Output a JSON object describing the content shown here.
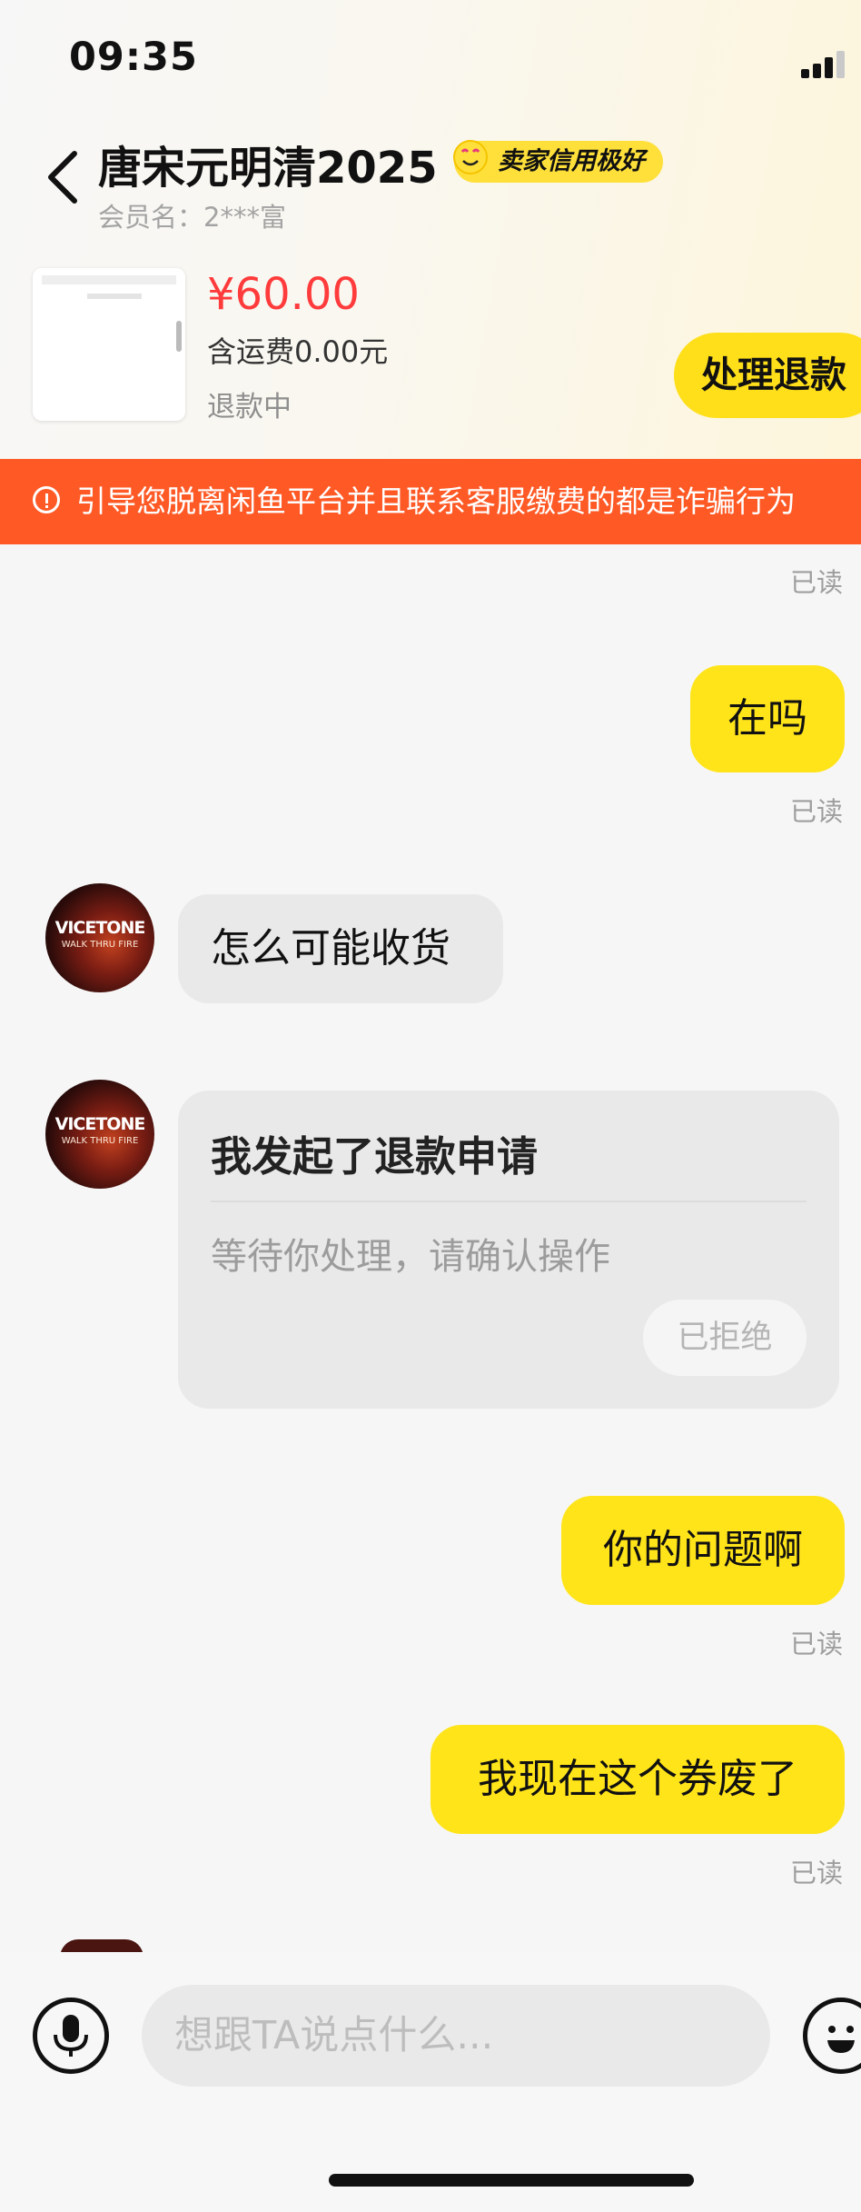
{
  "status_bar": {
    "time": "09:35"
  },
  "header": {
    "title": "唐宋元明清2025",
    "badge": "卖家信用极好",
    "member_label": "会员名：2***富"
  },
  "product": {
    "price": "¥60.00",
    "shipping": "含运费0.00元",
    "status": "退款中",
    "action_button": "处理退款"
  },
  "warning": {
    "text": "引导您脱离闲鱼平台并且联系客服缴费的都是诈骗行为"
  },
  "chat": {
    "read_label": "已读",
    "messages": [
      {
        "side": "out",
        "text": "在吗"
      },
      {
        "side": "in",
        "text": "怎么可能收货"
      },
      {
        "side": "out",
        "text": "你的问题啊"
      },
      {
        "side": "out",
        "text": "我现在这个券废了"
      }
    ],
    "refund_card": {
      "title": "我发起了退款申请",
      "desc": "等待你处理，请确认操作",
      "button": "已拒绝"
    },
    "avatar_brand": "VICETONE",
    "avatar_sub": "WALK THRU FIRE"
  },
  "input_bar": {
    "placeholder": "想跟TA说点什么..."
  },
  "colors": {
    "accent": "#ffe41a",
    "warning": "#ff5a26",
    "price": "#ff3b3b"
  },
  "icons": [
    "back-chevron-icon",
    "signal-icon",
    "warning-icon",
    "microphone-icon",
    "emoji-icon"
  ]
}
